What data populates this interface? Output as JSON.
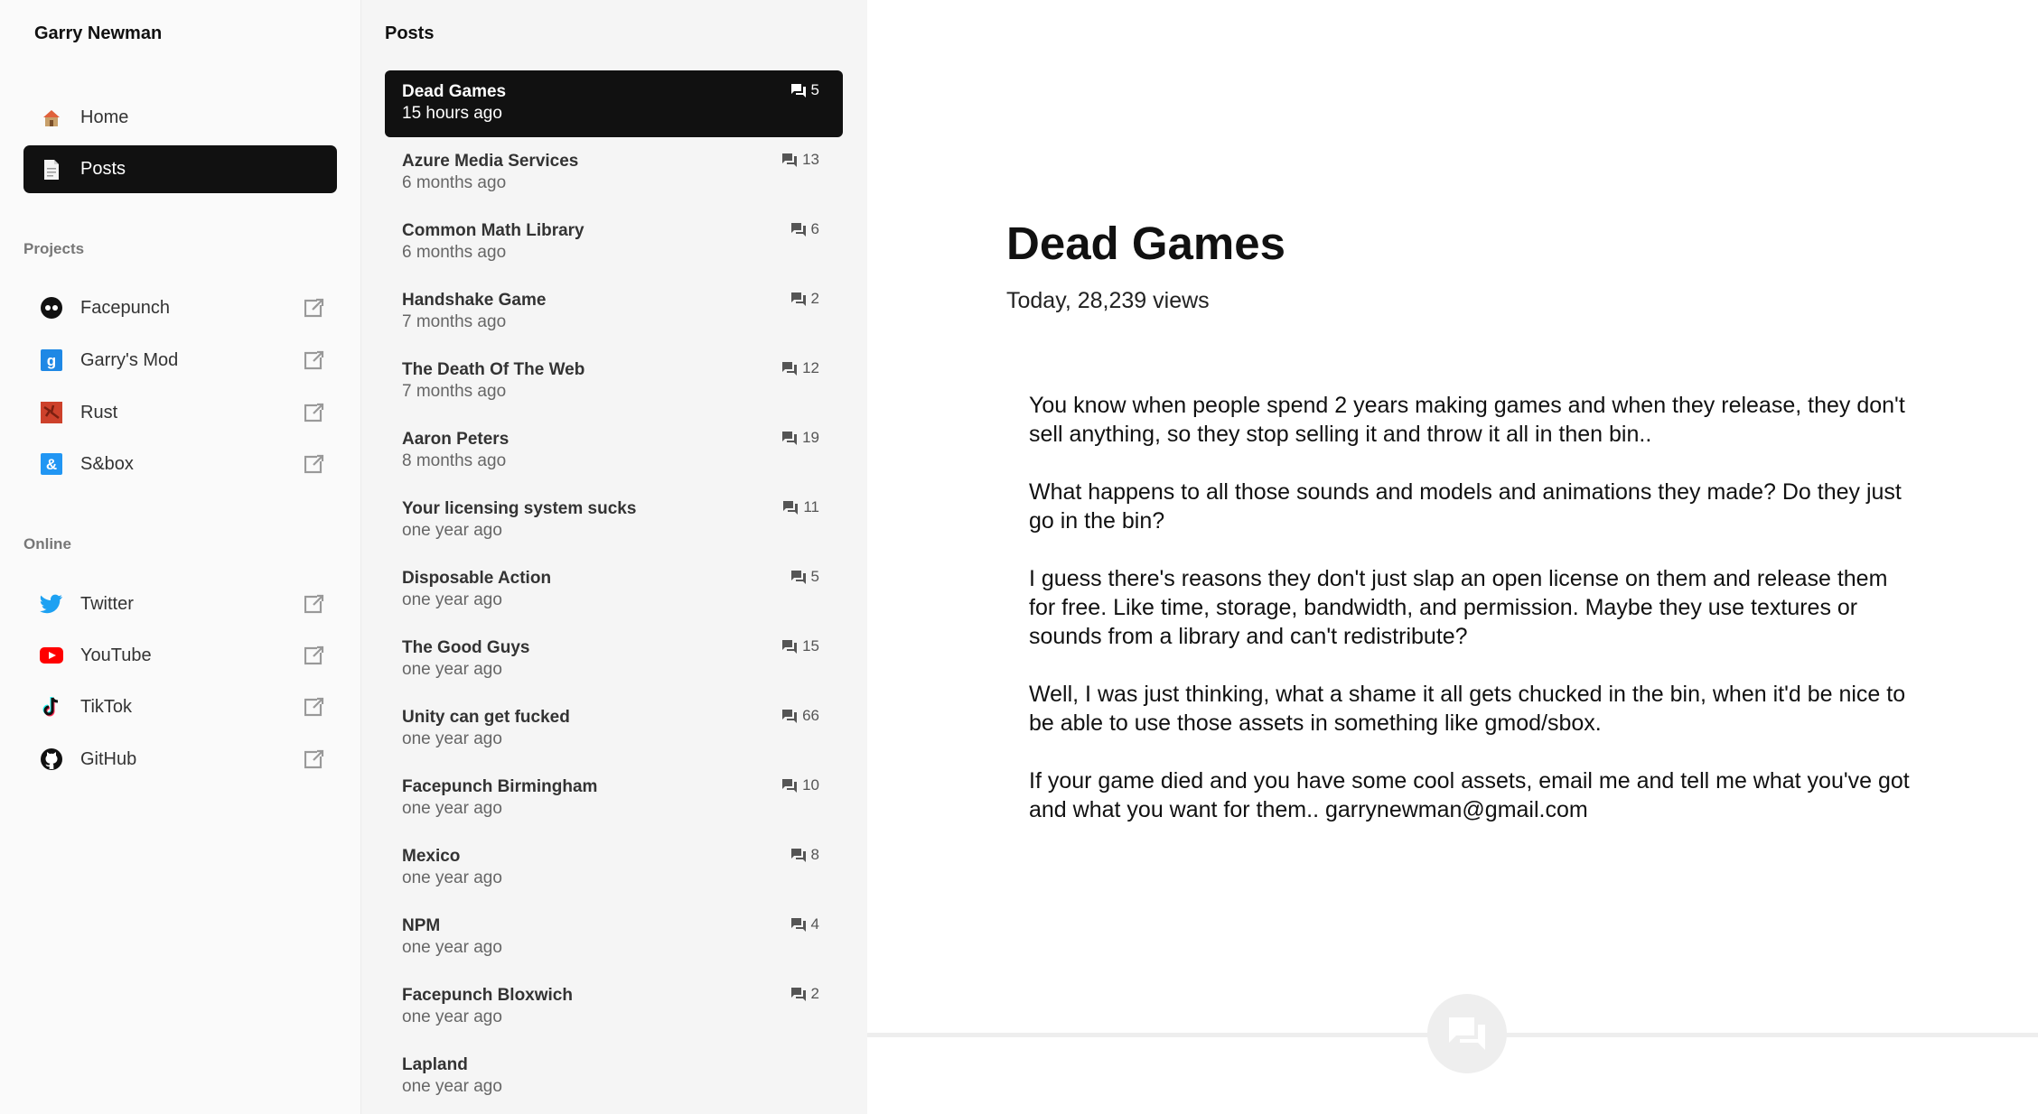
{
  "site": {
    "title": "Garry Newman"
  },
  "nav": [
    {
      "label": "Home",
      "icon": "house-icon",
      "active": false
    },
    {
      "label": "Posts",
      "icon": "page-icon",
      "active": true
    }
  ],
  "projects": {
    "label": "Projects",
    "items": [
      {
        "label": "Facepunch",
        "icon": "facepunch-icon"
      },
      {
        "label": "Garry's Mod",
        "icon": "garrys-mod-icon"
      },
      {
        "label": "Rust",
        "icon": "rust-icon"
      },
      {
        "label": "S&box",
        "icon": "sbox-icon"
      }
    ]
  },
  "online": {
    "label": "Online",
    "items": [
      {
        "label": "Twitter",
        "icon": "twitter-icon"
      },
      {
        "label": "YouTube",
        "icon": "youtube-icon"
      },
      {
        "label": "TikTok",
        "icon": "tiktok-icon"
      },
      {
        "label": "GitHub",
        "icon": "github-icon"
      }
    ]
  },
  "posts": {
    "heading": "Posts",
    "items": [
      {
        "title": "Dead Games",
        "date": "15 hours ago",
        "comments": "5",
        "active": true
      },
      {
        "title": "Azure Media Services",
        "date": "6 months ago",
        "comments": "13"
      },
      {
        "title": "Common Math Library",
        "date": "6 months ago",
        "comments": "6"
      },
      {
        "title": "Handshake Game",
        "date": "7 months ago",
        "comments": "2"
      },
      {
        "title": "The Death Of The Web",
        "date": "7 months ago",
        "comments": "12"
      },
      {
        "title": "Aaron Peters",
        "date": "8 months ago",
        "comments": "19"
      },
      {
        "title": "Your licensing system sucks",
        "date": "one year ago",
        "comments": "11"
      },
      {
        "title": "Disposable Action",
        "date": "one year ago",
        "comments": "5"
      },
      {
        "title": "The Good Guys",
        "date": "one year ago",
        "comments": "15"
      },
      {
        "title": "Unity can get fucked",
        "date": "one year ago",
        "comments": "66"
      },
      {
        "title": "Facepunch Birmingham",
        "date": "one year ago",
        "comments": "10"
      },
      {
        "title": "Mexico",
        "date": "one year ago",
        "comments": "8"
      },
      {
        "title": "NPM",
        "date": "one year ago",
        "comments": "4"
      },
      {
        "title": "Facepunch Bloxwich",
        "date": "one year ago",
        "comments": "2"
      },
      {
        "title": "Lapland",
        "date": "one year ago",
        "comments": ""
      }
    ]
  },
  "article": {
    "title": "Dead Games",
    "meta": "Today, 28,239 views",
    "paragraphs": [
      "You know when people spend 2 years making games and when they release, they don't sell anything, so they stop selling it and throw it all in then bin..",
      "What happens to all those sounds and models and animations they made? Do they just go in the bin?",
      "I guess there's reasons they don't just slap an open license on them and release them for free. Like time, storage, bandwidth, and permission. Maybe they use textures or sounds from a library and can't redistribute?",
      "Well, I was just thinking, what a shame it all gets chucked in the bin, when it'd be nice to be able to use those assets in something like gmod/sbox.",
      "If your game died and you have some cool assets, email me and tell me what you've got and what you want for them.. garrynewman@gmail.com"
    ]
  },
  "colors": {
    "active_bg": "#111111",
    "sidebar_bg": "#fafafa",
    "posts_bg": "#f5f5f5",
    "twitter": "#1da1f2",
    "youtube": "#ff0000",
    "garrysmod": "#1e88e5",
    "rust": "#cd412b",
    "sbox": "#2196f3"
  }
}
